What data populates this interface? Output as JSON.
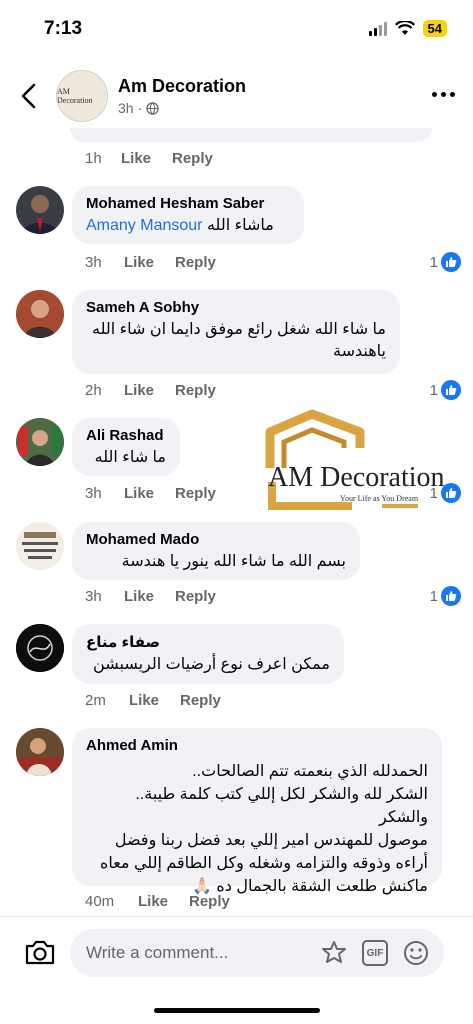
{
  "status_bar": {
    "time": "7:13",
    "battery": "54"
  },
  "header": {
    "page_name": "Am Decoration",
    "time_ago": "3h",
    "separator": "·",
    "avatar_text": "AM Decoration"
  },
  "top_comment": {
    "time": "1h",
    "like_label": "Like",
    "reply_label": "Reply"
  },
  "comments": [
    {
      "author": "Mohamed Hesham Saber",
      "mention": "Amany Mansour",
      "text": "ماشاء الله",
      "time": "3h",
      "like_label": "Like",
      "reply_label": "Reply",
      "like_count": "1"
    },
    {
      "author": "Sameh A Sobhy",
      "text": "ما شاء الله شغل رائع موفق دايما ان شاء الله ياهندسة",
      "time": "2h",
      "like_label": "Like",
      "reply_label": "Reply",
      "like_count": "1"
    },
    {
      "author": "Ali Rashad",
      "text": "ما شاء الله",
      "time": "3h",
      "like_label": "Like",
      "reply_label": "Reply",
      "like_count": "1"
    },
    {
      "author": "Mohamed Mado",
      "text": "بسم الله ما شاء الله ينور يا هندسة",
      "time": "3h",
      "like_label": "Like",
      "reply_label": "Reply",
      "like_count": "1"
    },
    {
      "author": "صفاء مناع",
      "text": "ممكن اعرف نوع أرضيات الريسبشن",
      "time": "2m",
      "like_label": "Like",
      "reply_label": "Reply"
    },
    {
      "author": "Ahmed Amin",
      "text_lines": [
        "الحمدلله الذي بنعمته تتم الصالحات..",
        "الشكر لله والشكر لكل إللي كتب كلمة طيبة.. والشكر",
        "موصول للمهندس امير إللي بعد فضل ربنا وفضل",
        "أراءه وذوقه والتزامه وشغله وكل الطاقم إللي معاه",
        "ماكنش طلعت الشقة بالجمال ده 🙏🏻"
      ],
      "time": "40m",
      "like_label": "Like",
      "reply_label": "Reply"
    }
  ],
  "watermark": {
    "title": "AM Decoration",
    "tagline": "Your Life as You Dream"
  },
  "composer": {
    "placeholder": "Write a comment...",
    "gif_label": "GIF"
  },
  "colors": {
    "accent": "#1877f2",
    "mention": "#216fdb",
    "bubble": "#f0f2f5",
    "meta": "#65676b",
    "battery": "#f7d300",
    "logo_gold": "#d9a441"
  },
  "icons": [
    "back-arrow-icon",
    "globe-icon",
    "more-icon",
    "like-icon",
    "camera-icon",
    "sticker-icon",
    "gif-icon",
    "emoji-icon"
  ]
}
